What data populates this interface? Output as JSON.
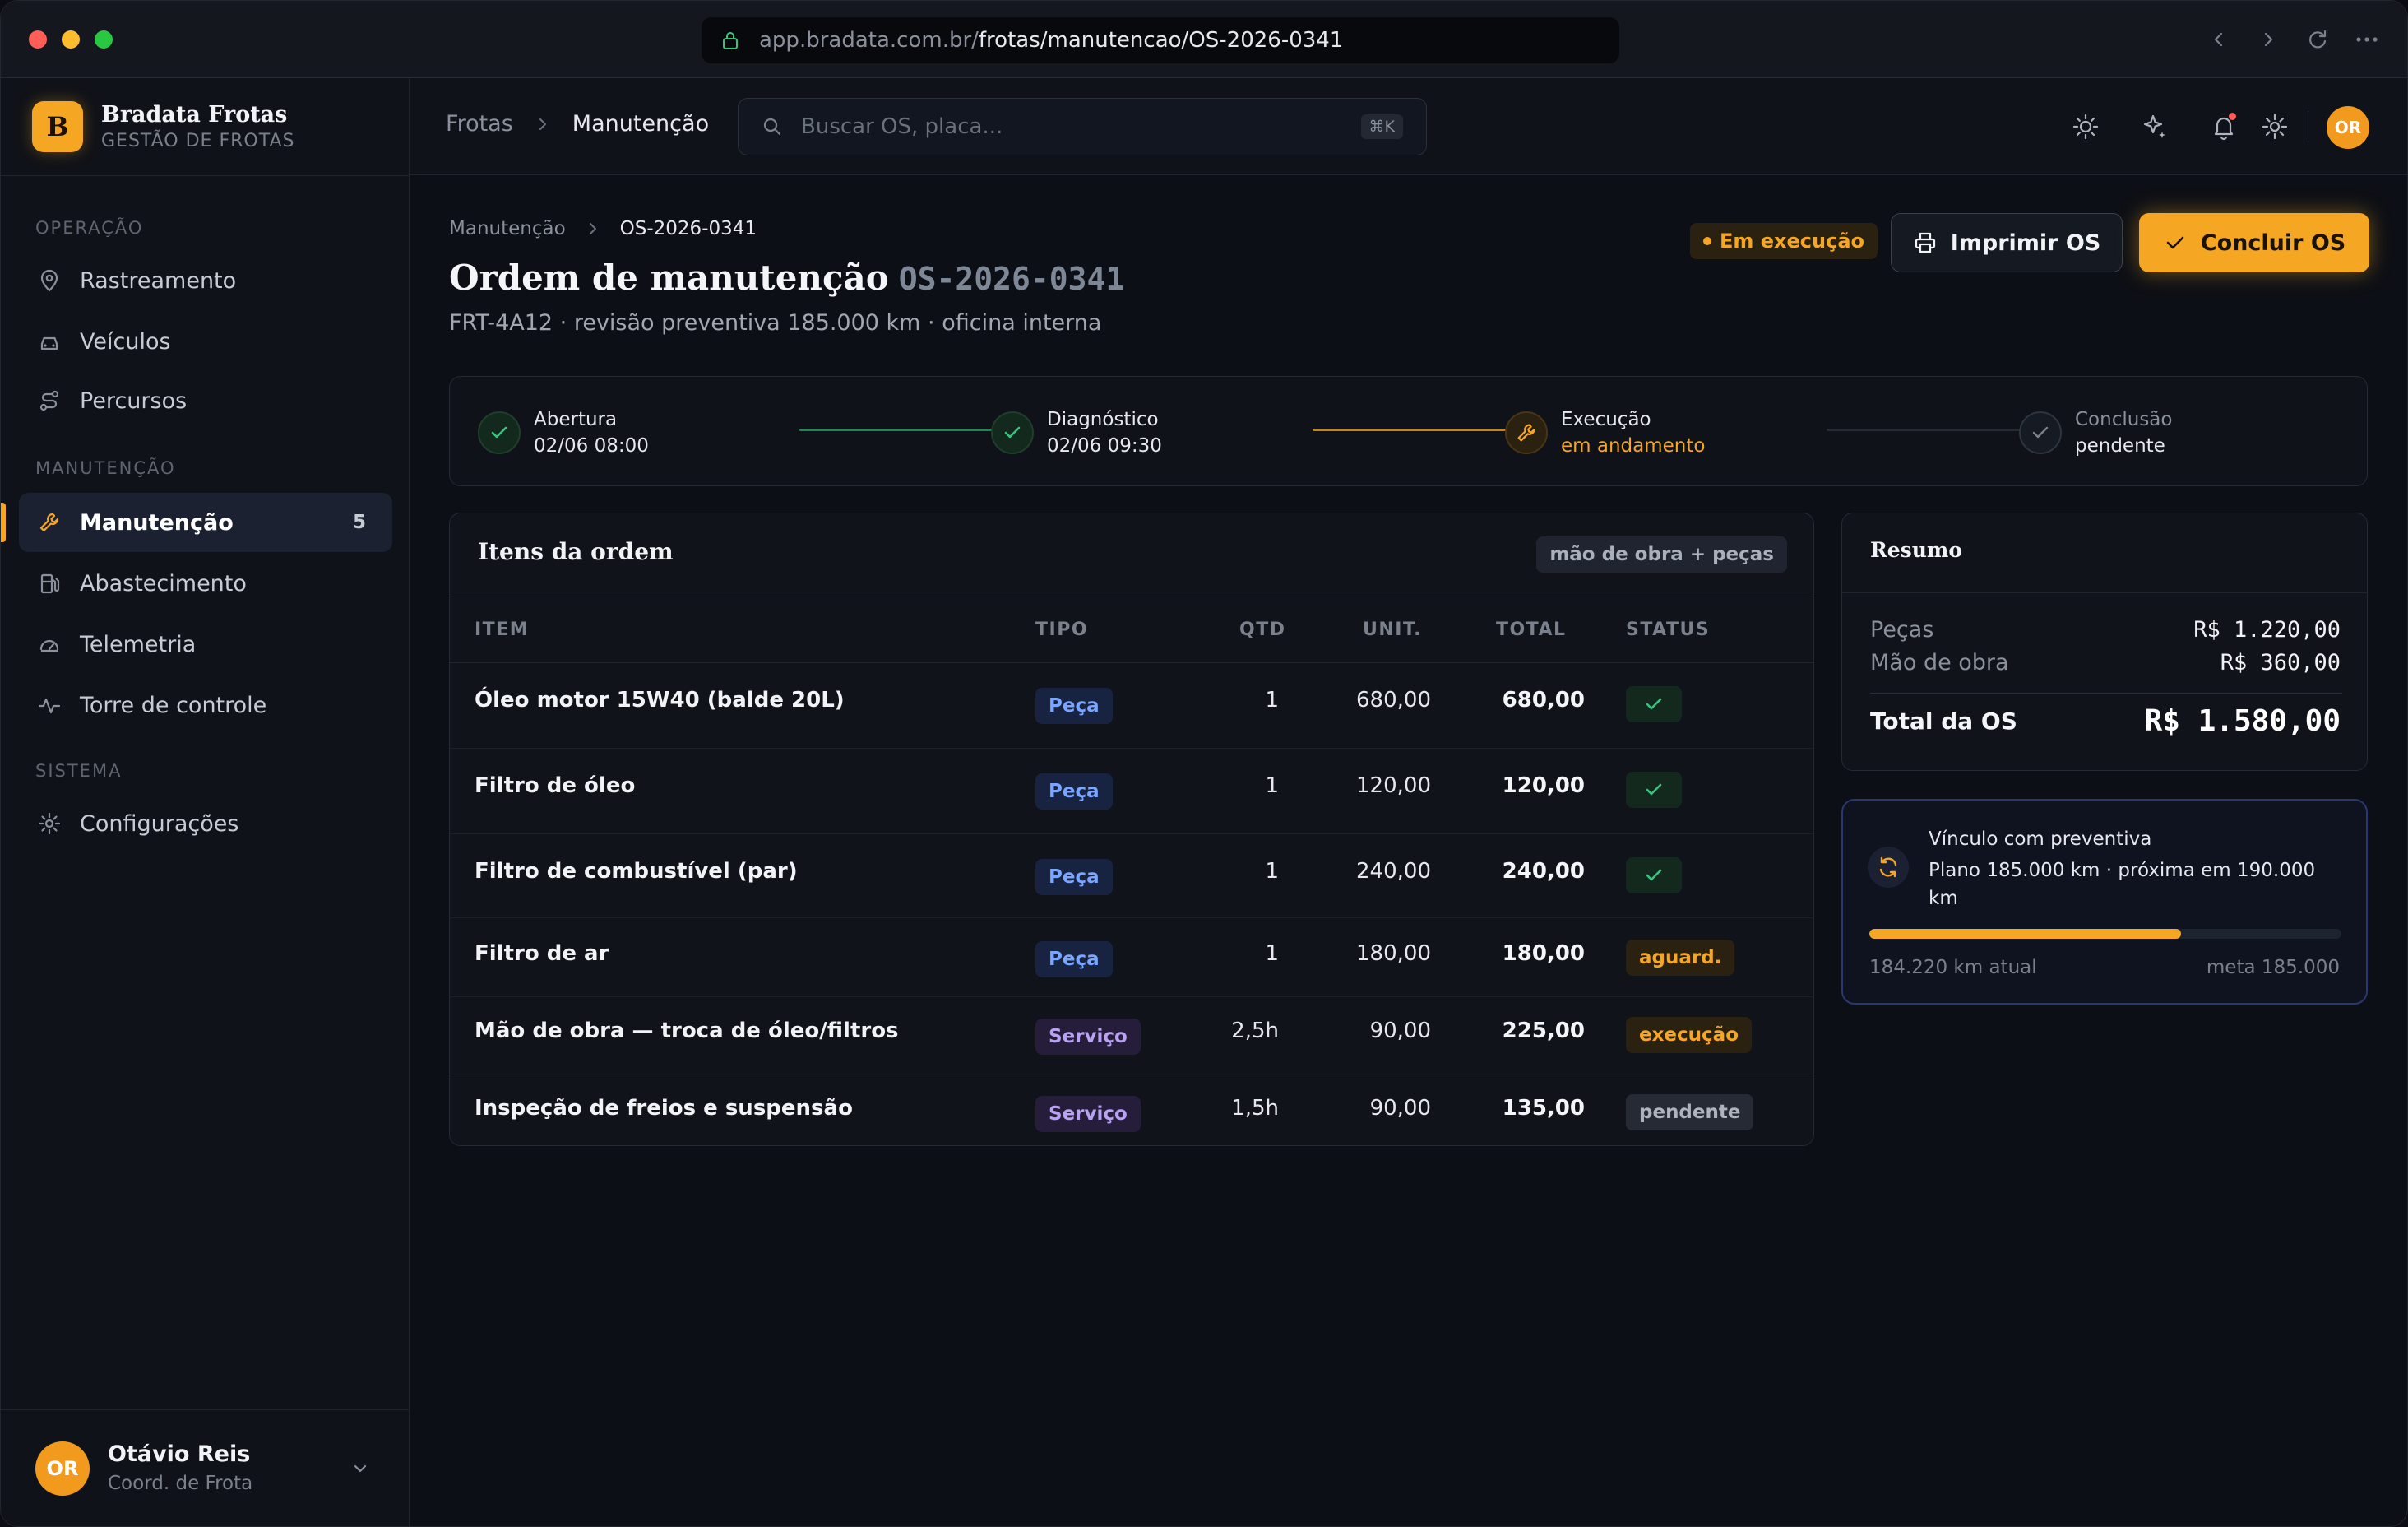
{
  "browser": {
    "url_host": "app.bradata.com.br/",
    "url_path": "frotas/manutencao/OS-2026-0341"
  },
  "brand": {
    "logo_letter": "B",
    "name": "Bradata Frotas",
    "subtitle": "GESTÃO DE FROTAS"
  },
  "sidebar": {
    "sections": [
      {
        "label": "OPERAÇÃO"
      },
      {
        "label": "MANUTENÇÃO"
      },
      {
        "label": "SISTEMA"
      }
    ],
    "items": [
      {
        "label": "Rastreamento",
        "icon": "location-pin-icon"
      },
      {
        "label": "Veículos",
        "icon": "car-icon"
      },
      {
        "label": "Percursos",
        "icon": "route-icon"
      },
      {
        "label": "Manutenção",
        "icon": "wrench-icon",
        "badge": "5",
        "active": true
      },
      {
        "label": "Abastecimento",
        "icon": "fuel-icon"
      },
      {
        "label": "Telemetria",
        "icon": "gauge-icon"
      },
      {
        "label": "Torre de controle",
        "icon": "activity-icon"
      },
      {
        "label": "Configurações",
        "icon": "gear-icon"
      }
    ],
    "user": {
      "initials": "OR",
      "name": "Otávio Reis",
      "role": "Coord. de Frota"
    }
  },
  "topbar": {
    "breadcrumb": [
      "Frotas",
      "Manutenção"
    ],
    "search_placeholder": "Buscar OS, placa...",
    "search_shortcut": "⌘K",
    "avatar_initials": "OR"
  },
  "page": {
    "breadcrumb": [
      "Manutenção",
      "OS-2026-0341"
    ],
    "title": "Ordem de manutenção",
    "os_code": "OS-2026-0341",
    "subtitle": "FRT-4A12 · revisão preventiva 185.000 km · oficina interna",
    "status": "Em execução",
    "print_label": "Imprimir OS",
    "conclude_label": "Concluir OS"
  },
  "steps": [
    {
      "label": "Abertura",
      "sub": "02/06 08:00",
      "state": "done"
    },
    {
      "label": "Diagnóstico",
      "sub": "02/06 09:30",
      "state": "done"
    },
    {
      "label": "Execução",
      "sub": "em andamento",
      "state": "current"
    },
    {
      "label": "Conclusão",
      "sub": "pendente",
      "state": "pending"
    }
  ],
  "items_card": {
    "title": "Itens da ordem",
    "tag": "mão de obra + peças",
    "columns": [
      "ITEM",
      "TIPO",
      "QTD",
      "UNIT.",
      "TOTAL",
      "STATUS"
    ],
    "rows": [
      {
        "item": "Óleo motor 15W40 (balde 20L)",
        "type": "Peça",
        "qty": "1",
        "unit": "680,00",
        "total": "680,00",
        "status": "ok"
      },
      {
        "item": "Filtro de óleo",
        "type": "Peça",
        "qty": "1",
        "unit": "120,00",
        "total": "120,00",
        "status": "ok"
      },
      {
        "item": "Filtro de combustível (par)",
        "type": "Peça",
        "qty": "1",
        "unit": "240,00",
        "total": "240,00",
        "status": "ok"
      },
      {
        "item": "Filtro de ar",
        "type": "Peça",
        "qty": "1",
        "unit": "180,00",
        "total": "180,00",
        "status": "aguard."
      },
      {
        "item": "Mão de obra — troca de óleo/filtros",
        "type": "Serviço",
        "qty": "2,5h",
        "unit": "90,00",
        "total": "225,00",
        "status": "execução"
      },
      {
        "item": "Inspeção de freios e suspensão",
        "type": "Serviço",
        "qty": "1,5h",
        "unit": "90,00",
        "total": "135,00",
        "status": "pendente"
      }
    ]
  },
  "summary": {
    "title": "Resumo",
    "parts_label": "Peças",
    "parts_value": "R$ 1.220,00",
    "labor_label": "Mão de obra",
    "labor_value": "R$ 360,00",
    "total_label": "Total da OS",
    "total_value": "R$ 1.580,00"
  },
  "preventive": {
    "title": "Vínculo com preventiva",
    "text": "Plano 185.000 km · próxima em 190.000 km",
    "progress_fraction": 0.66,
    "current_label": "184.220 km atual",
    "target_label": "meta 185.000"
  },
  "colors": {
    "accent": "#f5a623",
    "success": "#34c77b",
    "peca": "#7aa6ff",
    "servico": "#b9a2f2"
  }
}
